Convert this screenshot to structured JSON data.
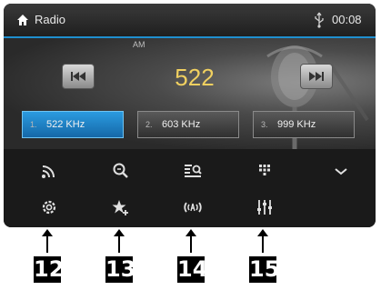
{
  "status_bar": {
    "title": "Radio",
    "time": "00:08",
    "icons": [
      "home-icon",
      "usb-icon"
    ]
  },
  "tuner": {
    "band": "AM",
    "frequency": "522",
    "presets": [
      {
        "index": "1.",
        "label": "522 KHz",
        "active": true
      },
      {
        "index": "2.",
        "label": "603 KHz",
        "active": false
      },
      {
        "index": "3.",
        "label": "999 KHz",
        "active": false
      }
    ]
  },
  "toolbar": {
    "row1": [
      "signal-icon",
      "search-icon",
      "list-search-icon",
      "keypad-icon",
      "chevron-down-icon"
    ],
    "row2": [
      "settings-icon",
      "favorite-add-icon",
      "traffic-announcement-icon",
      "equalizer-icon"
    ]
  },
  "callouts": [
    "12",
    "13",
    "14",
    "15"
  ],
  "colors": {
    "accent": "#1f8fcf",
    "frequency": "#f0d060",
    "preset_active": "#2b9be0"
  }
}
